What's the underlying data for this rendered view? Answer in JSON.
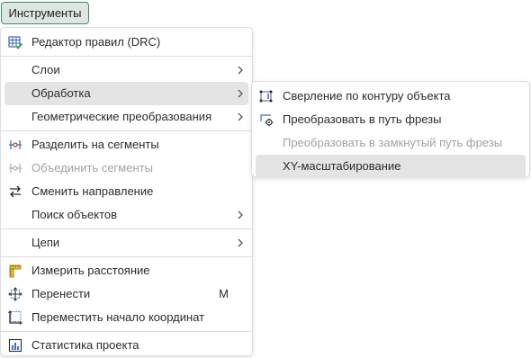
{
  "menubar": {
    "tools_label": "Инструменты"
  },
  "menu": {
    "drc": "Редактор правил (DRC)",
    "layers": "Слои",
    "processing": "Обработка",
    "geom_transform": "Геометрические преобразования",
    "split_segments": "Разделить на сегменты",
    "join_segments": "Объединить сегменты",
    "change_direction": "Сменить направление",
    "find_objects": "Поиск объектов",
    "chains": "Цепи",
    "measure_distance": "Измерить расстояние",
    "move": "Перенести",
    "move_shortcut": "M",
    "move_origin": "Переместить начало координат",
    "project_stats": "Статистика проекта"
  },
  "submenu": {
    "drill_contour": "Сверление по контуру объекта",
    "to_mill_path": "Преобразовать в путь фрезы",
    "to_closed_mill_path": "Преобразовать в замкнутый путь фрезы",
    "xy_scale": "XY-масштабирование"
  },
  "colors": {
    "accent": "#3b8f6c",
    "highlight": "#e4e4e4",
    "disabled": "#a2a2a2",
    "icon_blue": "#3f6fb5"
  }
}
